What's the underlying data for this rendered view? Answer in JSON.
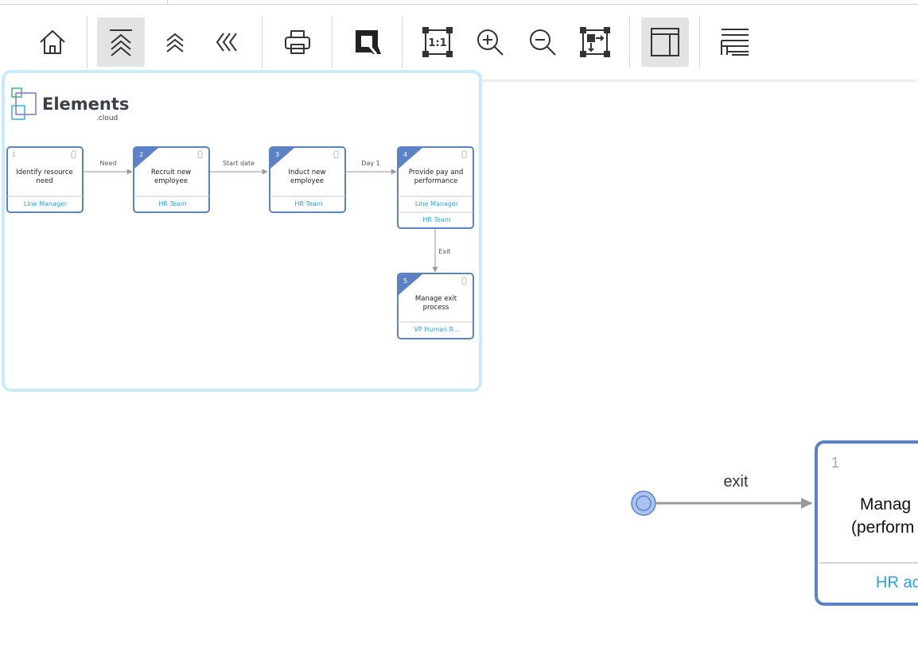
{
  "toolbar": {
    "buttons": [
      {
        "id": "home",
        "icon": "home-icon",
        "active": false
      },
      {
        "id": "go-top",
        "icon": "double-chevron-up-bar-icon",
        "active": true
      },
      {
        "id": "go-up",
        "icon": "double-chevron-up-icon",
        "active": false
      },
      {
        "id": "go-back",
        "icon": "triple-chevron-left-icon",
        "active": false
      },
      {
        "id": "print",
        "icon": "printer-icon",
        "active": false
      },
      {
        "id": "brand",
        "icon": "q-logo-icon",
        "active": false
      },
      {
        "id": "actual-size",
        "icon": "actual-size-icon",
        "label": "1:1",
        "active": false
      },
      {
        "id": "zoom-in",
        "icon": "zoom-in-icon",
        "active": false
      },
      {
        "id": "zoom-out",
        "icon": "zoom-out-icon",
        "active": false
      },
      {
        "id": "fit",
        "icon": "fit-to-screen-icon",
        "active": false
      },
      {
        "id": "panel",
        "icon": "panel-layout-icon",
        "active": true
      },
      {
        "id": "list",
        "icon": "list-outline-icon",
        "active": false
      }
    ]
  },
  "minimap": {
    "logo_text": "Elements",
    "logo_sub": ".cloud",
    "nodes": [
      {
        "num": "1",
        "title_l1": "Identify resource",
        "title_l2": "need",
        "roles": [
          "Line Manager"
        ]
      },
      {
        "num": "2",
        "title_l1": "Recruit new",
        "title_l2": "employee",
        "roles": [
          "HR Team"
        ]
      },
      {
        "num": "3",
        "title_l1": "Induct new",
        "title_l2": "employee",
        "roles": [
          "HR Team"
        ]
      },
      {
        "num": "4",
        "title_l1": "Provide pay and",
        "title_l2": "performance",
        "roles": [
          "Line Manager",
          "HR Team"
        ]
      },
      {
        "num": "5",
        "title_l1": "Manage exit",
        "title_l2": "process",
        "roles": [
          "VP Human R..."
        ]
      }
    ],
    "edges": [
      "Need",
      "Start date",
      "Day 1",
      "Exit"
    ]
  },
  "canvas": {
    "edge_label": "exit",
    "node": {
      "num": "1",
      "title_l1": "Manag",
      "title_l2": "(perform",
      "role": "HR ac"
    }
  },
  "colors": {
    "accent": "#5b82c6",
    "role_link": "#27a3e8",
    "minimap_border": "#c7ebfa",
    "start_event": "#a8c4ee"
  }
}
